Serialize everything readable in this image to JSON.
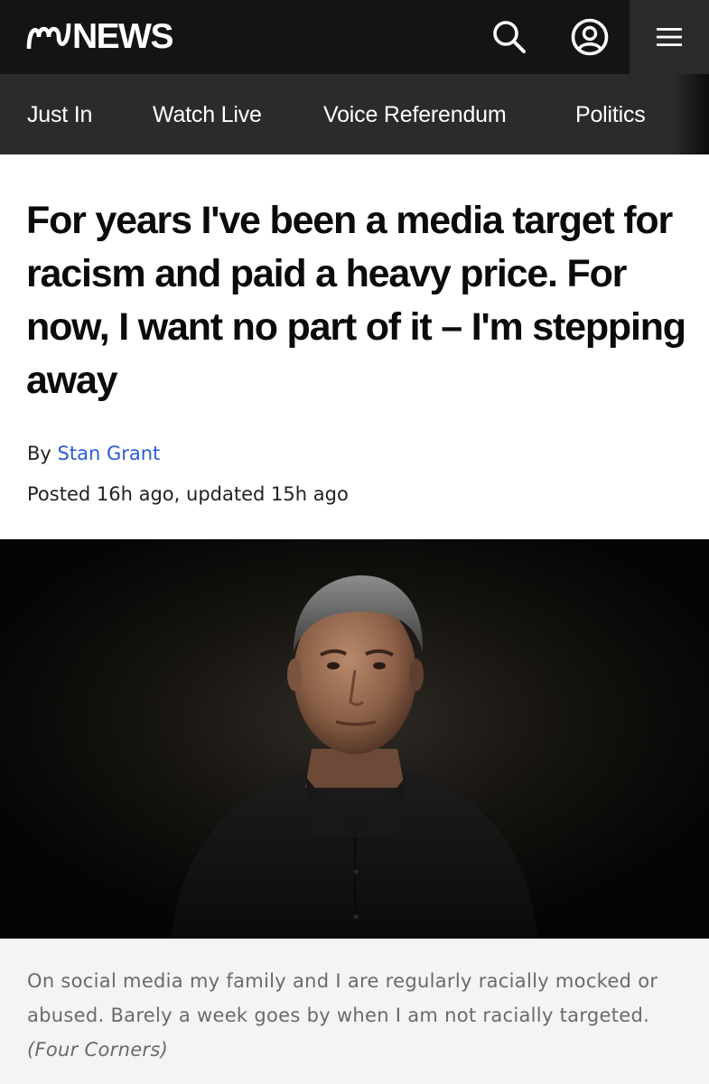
{
  "header": {
    "brand": "NEWS",
    "logo_icon": "abc-logo-icon",
    "search_icon": "search-icon",
    "account_icon": "account-icon",
    "menu_icon": "hamburger-menu-icon"
  },
  "nav": {
    "items": [
      {
        "label": "Just In"
      },
      {
        "label": "Watch Live"
      },
      {
        "label": "Voice Referendum"
      },
      {
        "label": "Politics"
      }
    ]
  },
  "article": {
    "headline": "For years I've been a media target for racism and paid a heavy price. For now, I want no part of it – I'm stepping away",
    "byline_prefix": "By",
    "author": "Stan Grant",
    "posted_label": "Posted",
    "posted_time": "16h ago",
    "separator": ",",
    "updated_label": "updated",
    "updated_time": "15h ago",
    "image": {
      "caption": "On social media my family and I are regularly racially mocked or abused. Barely a week goes by when I am not racially targeted.",
      "credit": "(Four Corners)"
    }
  },
  "colors": {
    "header_bg": "#141414",
    "nav_bg": "#2b2b2b",
    "link": "#2a5bd7",
    "caption_bg": "#f4f4f4",
    "caption_text": "#6a6a6a"
  }
}
